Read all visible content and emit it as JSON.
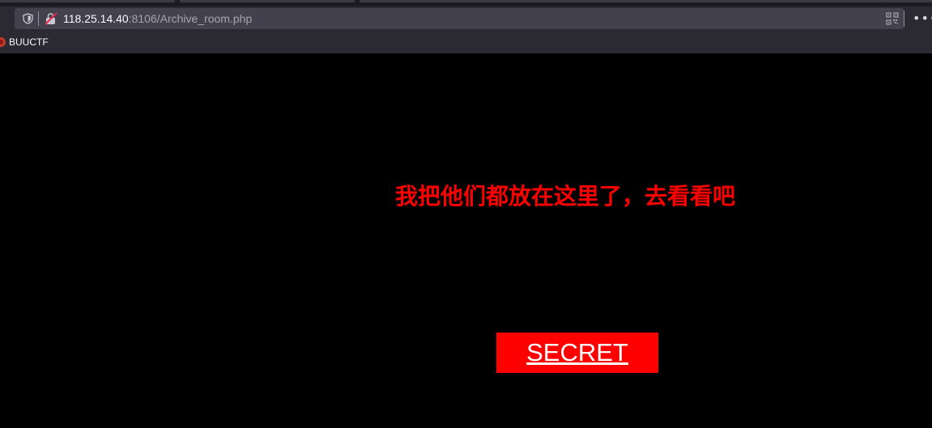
{
  "browser": {
    "url_host": "118.25.14.40",
    "url_rest": ":8106/Archive_room.php",
    "bookmarks": [
      {
        "label": "BUUCTF"
      }
    ]
  },
  "page": {
    "message": "我把他们都放在这里了，去看看吧",
    "secret_link_label": "SECRET"
  },
  "colors": {
    "background": "#000000",
    "message_text": "#ff0000",
    "button_background": "#ff0000",
    "button_text": "#ffffff"
  },
  "icons": {
    "url_left": "shield-icon",
    "security": "insecure-lock-icon",
    "url_right": "qr-code-icon",
    "menu": "more-menu-icon",
    "bookmark": "buuctf-favicon-icon"
  }
}
